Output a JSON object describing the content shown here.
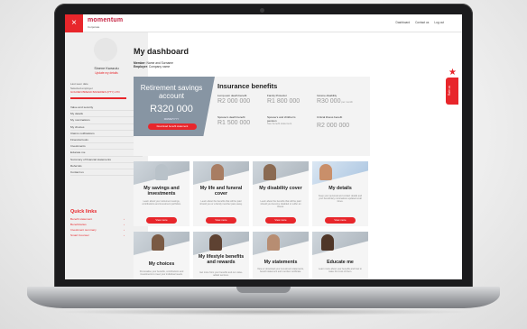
{
  "app": {
    "close_icon": "×",
    "logo": "momentum",
    "logo_sub": "Corporate",
    "topnav": [
      "Dashboard",
      "Contact us",
      "Log out"
    ]
  },
  "sidebar": {
    "name": "Sinene Kwazulu",
    "update": "Update my details",
    "meta": [
      "Last seen date",
      "Selected employer",
      "GOLDEN BREAD BAKERIES (PTY) LTD"
    ],
    "menu": [
      "Value and security",
      "My details",
      "My nominations",
      "My choices",
      "Claims notifications",
      "Financial tools",
      "Investments",
      "Educate me",
      "Summary of financial statements",
      "Referrals",
      "Contact us"
    ],
    "quicklinks_title": "Quick links",
    "quicklinks": [
      "Benefit statement",
      "Beneficiaries",
      "Investment summary",
      "Smart Counsel"
    ]
  },
  "main": {
    "title": "My dashboard",
    "member_label": "Member",
    "member_value": "Name and Surname",
    "employer_label": "Employer",
    "employer_value": "Company name"
  },
  "retirement": {
    "title": "Retirement savings account",
    "amount": "R320 000",
    "date": "DD/MM/YYYY",
    "button": "Download benefit statement"
  },
  "insurance": {
    "title": "Insurance benefits",
    "benefits": [
      {
        "label": "Lump-sum death benefit",
        "value": "R2 000 000",
        "suffix": ""
      },
      {
        "label": "Family Protector",
        "value": "R1 800 000",
        "suffix": ""
      },
      {
        "label": "Income disability",
        "value": "R30 000",
        "suffix": "per month"
      },
      {
        "label": "Spouse's death benefit",
        "value": "R1 500 000",
        "suffix": ""
      },
      {
        "label": "Spouse's and children's pension",
        "value": "See benefit statement",
        "suffix": ""
      },
      {
        "label": "Critical illness benefit",
        "value": "R2 000 000",
        "suffix": ""
      }
    ]
  },
  "rate_tab": {
    "label": "Rate us"
  },
  "cards": [
    {
      "title": "My savings and investments",
      "desc": "Learn about your retirement savings, contributions and investment portfolios.",
      "button": "View more"
    },
    {
      "title": "My life and funeral cover",
      "desc": "Learn about the benefits that will be paid should you or a family member pass away.",
      "button": "View more"
    },
    {
      "title": "My disability cover",
      "desc": "Learn about the benefits that will be paid should you become disabled or suffer an illness.",
      "button": "View more"
    },
    {
      "title": "My details",
      "desc": "Keep your personal and contact details and your beneficiary nominations updated at all times.",
      "button": "View more"
    },
    {
      "title": "My choices",
      "desc": "Personalise your benefits, contributions and investments to meet your individual needs.",
      "button": ""
    },
    {
      "title": "My lifestyle benefits and rewards",
      "desc": "Get more from your benefits and our value-added services.",
      "button": ""
    },
    {
      "title": "My statements",
      "desc": "View or download your investment statements, benefit statement and member certificate.",
      "button": ""
    },
    {
      "title": "Educate me",
      "desc": "Learn more about your benefits and how to make the most of them.",
      "button": ""
    }
  ],
  "colors": {
    "accent": "#e8262b",
    "retirement_panel": "#8795a3"
  }
}
